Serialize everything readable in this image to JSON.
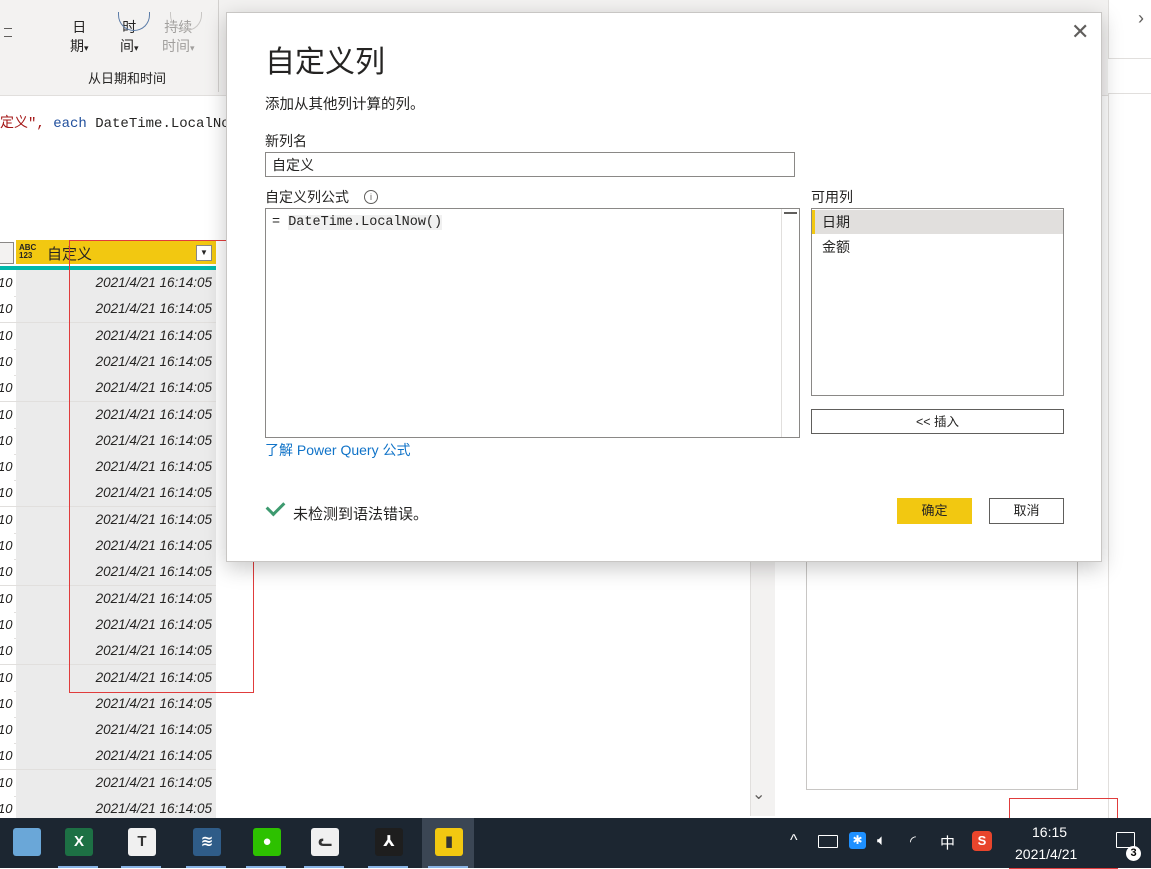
{
  "ribbon": {
    "buttons": [
      {
        "line1": "日",
        "line2": "期"
      },
      {
        "line1": "时",
        "line2": "间"
      },
      {
        "line1": "持续",
        "line2": "时间"
      }
    ],
    "group_label": "从日期和时间"
  },
  "formula_bar": {
    "prefix": "定义\", ",
    "keyword": "each",
    "expression": " DateTime.LocalNow"
  },
  "grid": {
    "column_type": "ABC\n123",
    "column_name": "自定义",
    "left_value": "10",
    "value": "2021/4/21 16:14:05",
    "rows": [
      {
        "left": "10",
        "value": "2021/4/21 16:14:05"
      },
      {
        "left": "10",
        "value": "2021/4/21 16:14:05"
      },
      {
        "left": "10",
        "value": "2021/4/21 16:14:05"
      },
      {
        "left": "10",
        "value": "2021/4/21 16:14:05"
      },
      {
        "left": "10",
        "value": "2021/4/21 16:14:05"
      },
      {
        "left": "10",
        "value": "2021/4/21 16:14:05"
      },
      {
        "left": "10",
        "value": "2021/4/21 16:14:05"
      },
      {
        "left": "10",
        "value": "2021/4/21 16:14:05"
      },
      {
        "left": "10",
        "value": "2021/4/21 16:14:05"
      },
      {
        "left": "10",
        "value": "2021/4/21 16:14:05"
      },
      {
        "left": "10",
        "value": "2021/4/21 16:14:05"
      },
      {
        "left": "10",
        "value": "2021/4/21 16:14:05"
      },
      {
        "left": "10",
        "value": "2021/4/21 16:14:05"
      },
      {
        "left": "10",
        "value": "2021/4/21 16:14:05"
      },
      {
        "left": "10",
        "value": "2021/4/21 16:14:05"
      },
      {
        "left": "10",
        "value": "2021/4/21 16:14:05"
      },
      {
        "left": "10",
        "value": "2021/4/21 16:14:05"
      },
      {
        "left": "10",
        "value": "2021/4/21 16:14:05"
      },
      {
        "left": "10",
        "value": "2021/4/21 16:14:05"
      },
      {
        "left": "10",
        "value": "2021/4/21 16:14:05"
      },
      {
        "left": "10",
        "value": "2021/4/21 16:14:05"
      }
    ]
  },
  "dialog": {
    "title": "自定义列",
    "close": "✕",
    "subtitle": "添加从其他列计算的列。",
    "new_column_label": "新列名",
    "new_column_value": "自定义",
    "formula_label": "自定义列公式",
    "info_icon": "i",
    "formula_prefix": "= ",
    "formula_body": "DateTime.LocalNow()",
    "learn_link": "了解 Power Query 公式",
    "available_label": "可用列",
    "available_columns": [
      {
        "name": "日期",
        "selected": true
      },
      {
        "name": "金额",
        "selected": false
      }
    ],
    "insert_button": "<< 插入",
    "status": "未检测到语法错误。",
    "ok_button": "确定",
    "cancel_button": "取消"
  },
  "taskbar": {
    "apps": [
      {
        "name": "notepad",
        "glyph": "",
        "color": "#6aa7d8"
      },
      {
        "name": "excel",
        "glyph": "X",
        "color": "#1d7044"
      },
      {
        "name": "typora",
        "glyph": "T",
        "color": "#f0f0f0"
      },
      {
        "name": "mysql-workbench",
        "glyph": "≋",
        "color": "#2f5c88"
      },
      {
        "name": "wechat",
        "glyph": "●",
        "color": "#2dc100"
      },
      {
        "name": "cat-app",
        "glyph": "ᓚ",
        "color": "#f0f0f0"
      },
      {
        "name": "acrobat",
        "glyph": "⅄",
        "color": "#1e1e1e"
      },
      {
        "name": "power-bi",
        "glyph": "▮",
        "color": "#f2c811"
      }
    ],
    "tray": {
      "chevron": "^",
      "ime": "中",
      "time": "16:15",
      "date": "2021/4/21",
      "notifications": "3"
    }
  }
}
